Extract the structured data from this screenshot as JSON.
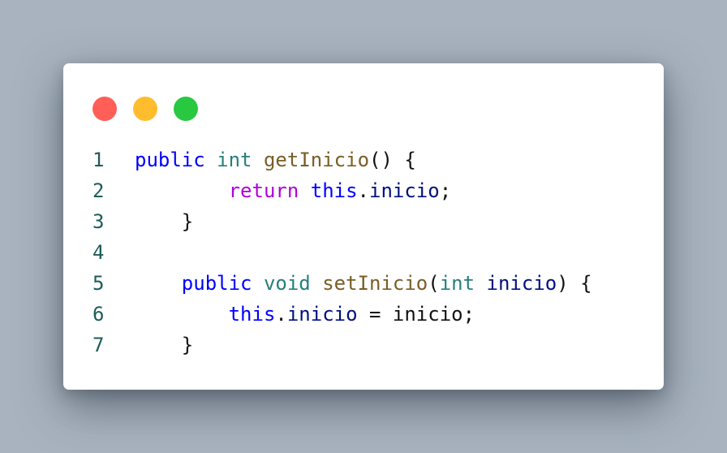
{
  "colors": {
    "background": "#a8b3bf",
    "card": "#ffffff",
    "dot_close": "#ff5f57",
    "dot_minimize": "#ffbd2e",
    "dot_maximize": "#28c840",
    "keyword": "#0000ff",
    "return_keyword": "#af00db",
    "type": "#267f7a",
    "function_name": "#795e26",
    "variable": "#001080",
    "punctuation": "#111111",
    "line_number": "#1e5c5a"
  },
  "window": {
    "controls": [
      {
        "name": "close",
        "color": "#ff5f57"
      },
      {
        "name": "minimize",
        "color": "#ffbd2e"
      },
      {
        "name": "maximize",
        "color": "#28c840"
      }
    ]
  },
  "code": {
    "language": "java",
    "lines": [
      {
        "number": "1",
        "tokens": [
          {
            "text": "public",
            "kind": "keyword"
          },
          {
            "text": " ",
            "kind": "plain"
          },
          {
            "text": "int",
            "kind": "type"
          },
          {
            "text": " ",
            "kind": "plain"
          },
          {
            "text": "getInicio",
            "kind": "function_name"
          },
          {
            "text": "() {",
            "kind": "punctuation"
          }
        ]
      },
      {
        "number": "2",
        "tokens": [
          {
            "text": "        ",
            "kind": "plain"
          },
          {
            "text": "return",
            "kind": "return_keyword"
          },
          {
            "text": " ",
            "kind": "plain"
          },
          {
            "text": "this",
            "kind": "keyword"
          },
          {
            "text": ".",
            "kind": "punctuation"
          },
          {
            "text": "inicio",
            "kind": "variable"
          },
          {
            "text": ";",
            "kind": "punctuation"
          }
        ]
      },
      {
        "number": "3",
        "tokens": [
          {
            "text": "    ",
            "kind": "plain"
          },
          {
            "text": "}",
            "kind": "punctuation"
          }
        ]
      },
      {
        "number": "4",
        "tokens": []
      },
      {
        "number": "5",
        "tokens": [
          {
            "text": "    ",
            "kind": "plain"
          },
          {
            "text": "public",
            "kind": "keyword"
          },
          {
            "text": " ",
            "kind": "plain"
          },
          {
            "text": "void",
            "kind": "type"
          },
          {
            "text": " ",
            "kind": "plain"
          },
          {
            "text": "setInicio",
            "kind": "function_name"
          },
          {
            "text": "(",
            "kind": "punctuation"
          },
          {
            "text": "int",
            "kind": "type"
          },
          {
            "text": " ",
            "kind": "plain"
          },
          {
            "text": "inicio",
            "kind": "variable"
          },
          {
            "text": ") {",
            "kind": "punctuation"
          }
        ]
      },
      {
        "number": "6",
        "tokens": [
          {
            "text": "        ",
            "kind": "plain"
          },
          {
            "text": "this",
            "kind": "keyword"
          },
          {
            "text": ".",
            "kind": "punctuation"
          },
          {
            "text": "inicio",
            "kind": "variable"
          },
          {
            "text": " = inicio;",
            "kind": "punctuation"
          }
        ]
      },
      {
        "number": "7",
        "tokens": [
          {
            "text": "    ",
            "kind": "plain"
          },
          {
            "text": "}",
            "kind": "punctuation"
          }
        ]
      }
    ]
  }
}
